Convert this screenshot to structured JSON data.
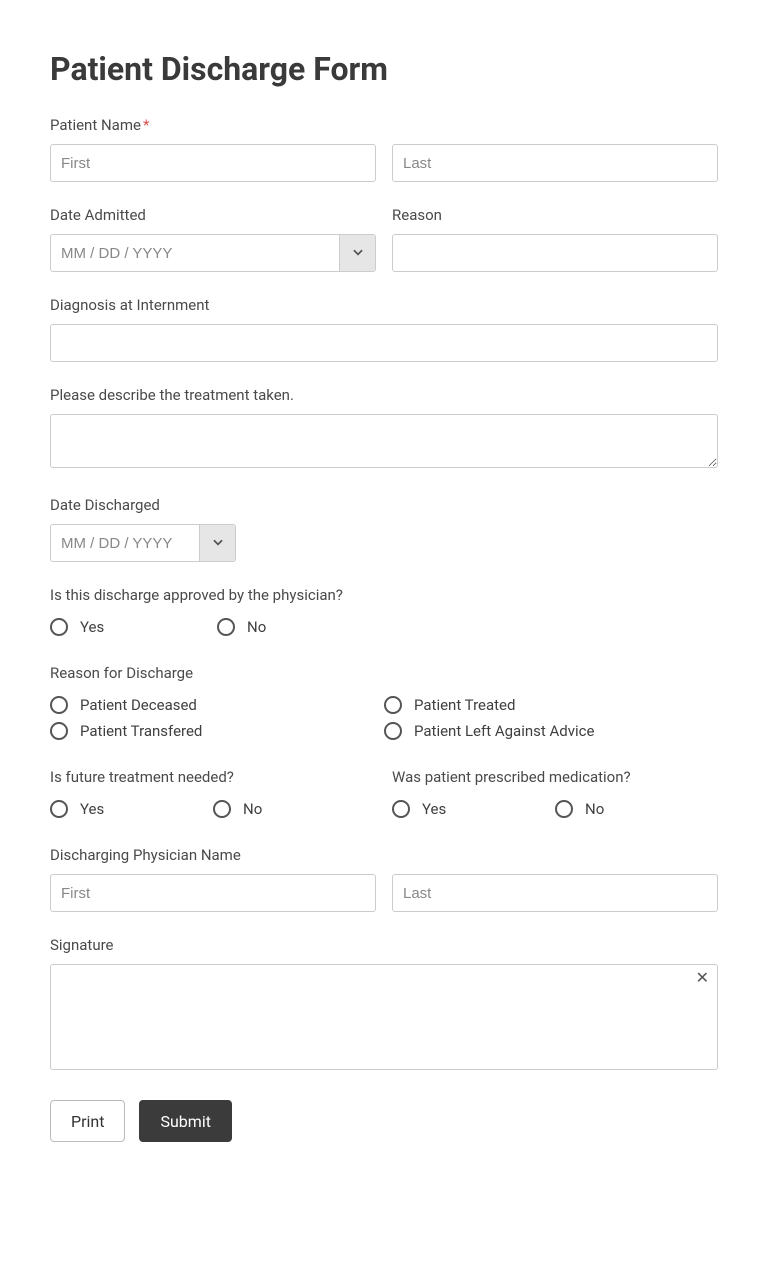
{
  "title": "Patient Discharge Form",
  "fields": {
    "patient_name": {
      "label": "Patient Name",
      "required": "*",
      "first_ph": "First",
      "last_ph": "Last"
    },
    "date_admitted": {
      "label": "Date Admitted",
      "placeholder": "MM / DD / YYYY"
    },
    "reason": {
      "label": "Reason"
    },
    "diagnosis": {
      "label": "Diagnosis at Internment"
    },
    "treatment": {
      "label": "Please describe the treatment taken."
    },
    "date_discharged": {
      "label": "Date Discharged",
      "placeholder": "MM / DD / YYYY"
    },
    "approved": {
      "label": "Is this discharge approved by the physician?",
      "yes": "Yes",
      "no": "No"
    },
    "reason_discharge": {
      "label": "Reason for Discharge",
      "opt1": "Patient Deceased",
      "opt2": "Patient Treated",
      "opt3": "Patient Transfered",
      "opt4": "Patient Left Against Advice"
    },
    "future": {
      "label": "Is future treatment needed?",
      "yes": "Yes",
      "no": "No"
    },
    "medication": {
      "label": "Was patient prescribed medication?",
      "yes": "Yes",
      "no": "No"
    },
    "physician": {
      "label": "Discharging Physician Name",
      "first_ph": "First",
      "last_ph": "Last"
    },
    "signature": {
      "label": "Signature"
    }
  },
  "buttons": {
    "print": "Print",
    "submit": "Submit"
  }
}
